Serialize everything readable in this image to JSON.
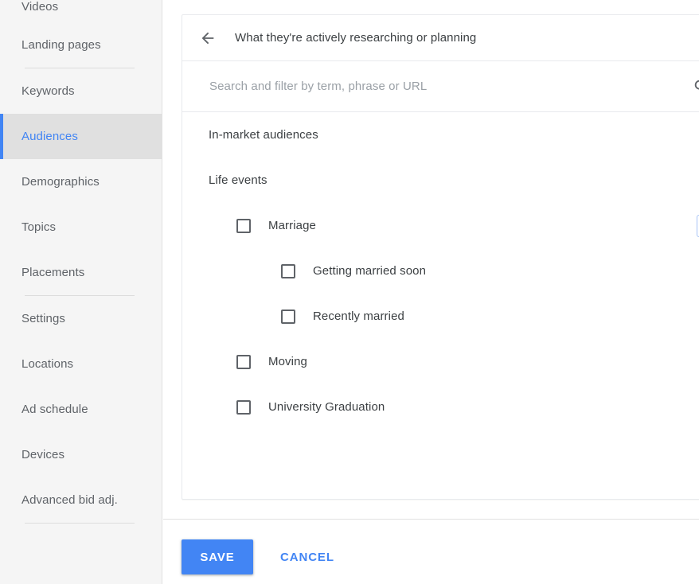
{
  "sidebar": {
    "items": [
      {
        "label": "Videos",
        "active": false,
        "partial": true
      },
      {
        "label": "Landing pages",
        "active": false
      },
      {
        "label": "Keywords",
        "active": false
      },
      {
        "label": "Audiences",
        "active": true
      },
      {
        "label": "Demographics",
        "active": false
      },
      {
        "label": "Topics",
        "active": false
      },
      {
        "label": "Placements",
        "active": false
      },
      {
        "label": "Settings",
        "active": false
      },
      {
        "label": "Locations",
        "active": false
      },
      {
        "label": "Ad schedule",
        "active": false
      },
      {
        "label": "Devices",
        "active": false
      },
      {
        "label": "Advanced bid adj.",
        "active": false
      }
    ]
  },
  "card": {
    "back_icon": "back-arrow-icon",
    "title": "What they're actively researching or planning",
    "search": {
      "icon": "search-icon",
      "value": "",
      "placeholder": "Search and filter by term, phrase or URL"
    },
    "tree": [
      {
        "label": "In-market audiences",
        "level": "section",
        "expanded": false,
        "chevron": "chevron-down-icon",
        "checkbox": false
      },
      {
        "label": "Life events",
        "level": "section",
        "expanded": true,
        "chevron": "chevron-up-icon",
        "checkbox": false
      },
      {
        "label": "Marriage",
        "level": "level1",
        "expanded": true,
        "chevron": "chevron-up-icon",
        "checkbox": true,
        "checked": false,
        "focused": true
      },
      {
        "label": "Getting married soon",
        "level": "level2",
        "chevron": null,
        "checkbox": true,
        "checked": false
      },
      {
        "label": "Recently married",
        "level": "level2",
        "chevron": null,
        "checkbox": true,
        "checked": false
      },
      {
        "label": "Moving",
        "level": "level1",
        "expanded": false,
        "chevron": "chevron-down-icon",
        "checkbox": true,
        "checked": false
      },
      {
        "label": "University Graduation",
        "level": "level1",
        "expanded": false,
        "chevron": "chevron-down-icon",
        "checkbox": true,
        "checked": false
      }
    ]
  },
  "footer": {
    "save_label": "SAVE",
    "cancel_label": "CANCEL"
  },
  "colors": {
    "accent": "#4285f4",
    "sidebar_bg": "#f5f5f5",
    "active_bg": "#e0e0e0",
    "text": "#3c4043",
    "muted_text": "#5f6368",
    "placeholder": "#9aa0a6",
    "border": "#e8eaed",
    "focus_border": "#a7c4f7"
  }
}
